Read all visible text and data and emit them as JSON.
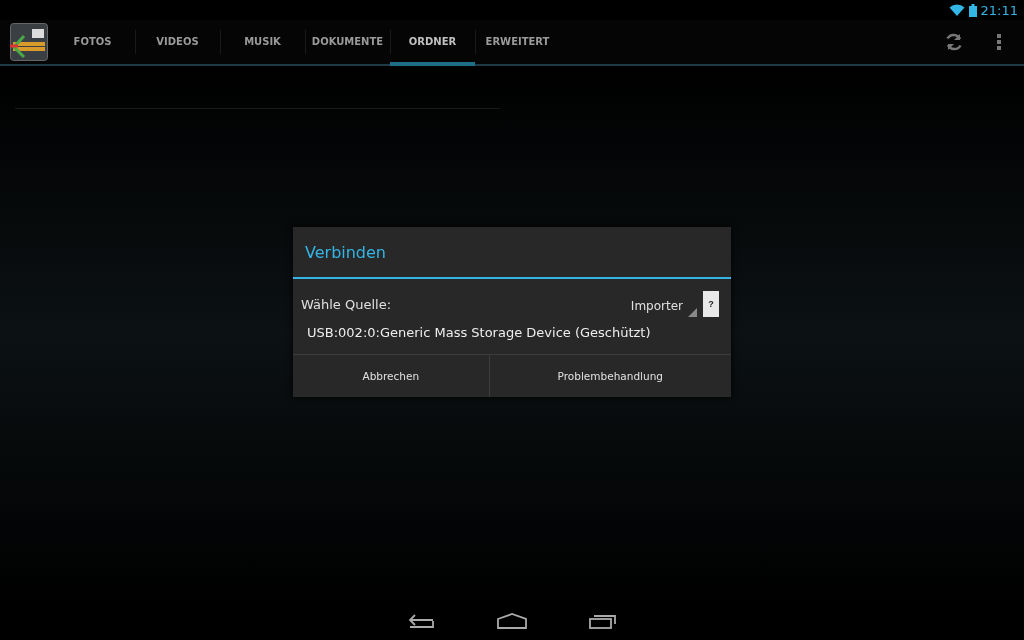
{
  "status_bar": {
    "time": "21:11"
  },
  "tabs": [
    {
      "label": "FOTOS",
      "selected": false
    },
    {
      "label": "VIDEOS",
      "selected": false
    },
    {
      "label": "MUSIK",
      "selected": false
    },
    {
      "label": "DOKUMENTE",
      "selected": false
    },
    {
      "label": "ORDNER",
      "selected": true
    },
    {
      "label": "ERWEITERT",
      "selected": false
    }
  ],
  "dialog": {
    "title": "Verbinden",
    "source_label": "Wähle Quelle:",
    "mode_spinner": {
      "value": "Importer"
    },
    "help_button": "?",
    "sources": [
      {
        "name": "USB:002:0:Generic Mass Storage Device (Geschützt)"
      }
    ],
    "buttons": [
      "Abbrechen",
      "Problembehandlung"
    ]
  }
}
